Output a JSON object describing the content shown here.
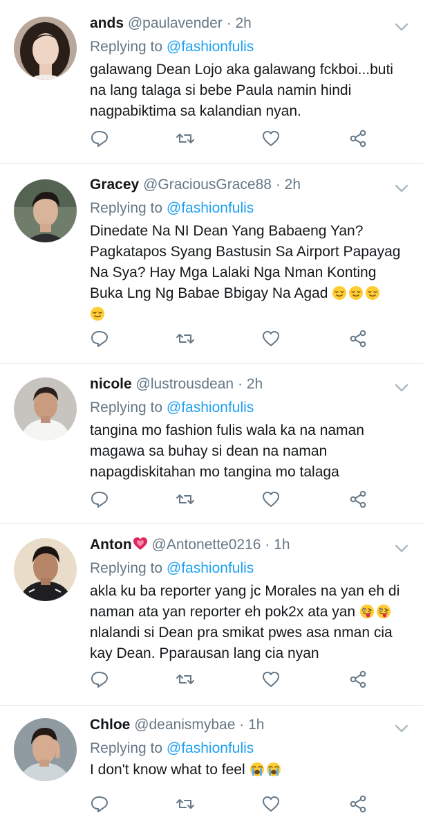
{
  "tweets": [
    {
      "name": "ands",
      "handle": "@paulavender",
      "sep": "·",
      "time": "2h",
      "reply_prefix": "Replying to",
      "reply_to": "@fashionfulis",
      "lines": [
        "galawang Dean Lojo aka galawang fckboi...buti",
        "na lang talaga si bebe Paula namin hindi",
        "nagpabiktima sa kalandian nyan."
      ],
      "emoji": []
    },
    {
      "name": "Gracey",
      "handle": "@GraciousGrace88",
      "sep": "·",
      "time": "2h",
      "reply_prefix": "Replying to",
      "reply_to": "@fashionfulis",
      "lines": [
        "Dinedate Na NI Dean Yang Babaeng Yan?",
        "Pagkatapos Syang Bastusin Sa Airport Papayag",
        "Na Sya? Hay Mga Lalaki Nga Nman Konting",
        "Buka Lng Ng Babae Bbigay Na Agad"
      ],
      "emoji": [
        "relieved-face",
        "relieved-face",
        "relieved-face",
        "relieved-face"
      ]
    },
    {
      "name": "nicole",
      "handle": "@lustrousdean",
      "sep": "·",
      "time": "2h",
      "reply_prefix": "Replying to",
      "reply_to": "@fashionfulis",
      "lines": [
        "tangina mo fashion fulis wala ka na naman",
        "magawa sa buhay si dean na naman",
        "napagdiskitahan mo tangina mo talaga"
      ],
      "emoji": []
    },
    {
      "name": "Anton",
      "handle": "@Antonette0216",
      "sep": "·",
      "time": "1h",
      "reply_prefix": "Replying to",
      "reply_to": "@fashionfulis",
      "lines": [
        "akla ku ba reporter yang jc Morales na yan eh di",
        "naman ata yan reporter eh pok2x ata yan",
        "nlalandi si Dean pra smikat pwes asa nman cia",
        "kay Dean. Pparausan lang cia nyan"
      ],
      "emoji": [
        "winking-tongue-face",
        "winking-tongue-face"
      ],
      "name_emoji": "growing-heart"
    },
    {
      "name": "Chloe",
      "handle": "@deanismybae",
      "sep": "·",
      "time": "1h",
      "reply_prefix": "Replying to",
      "reply_to": "@fashionfulis",
      "lines": [
        "I don't know what to feel"
      ],
      "emoji": [
        "loudly-crying-face",
        "loudly-crying-face"
      ]
    }
  ],
  "icons": {
    "reply": "speech-bubble-icon",
    "retweet": "retweet-icon",
    "like": "heart-icon",
    "share": "share-icon",
    "more": "chevron-down-icon"
  },
  "colors": {
    "accent": "#1da1f2",
    "muted": "#657786",
    "text": "#14171a",
    "divider": "#e1e8ed"
  }
}
